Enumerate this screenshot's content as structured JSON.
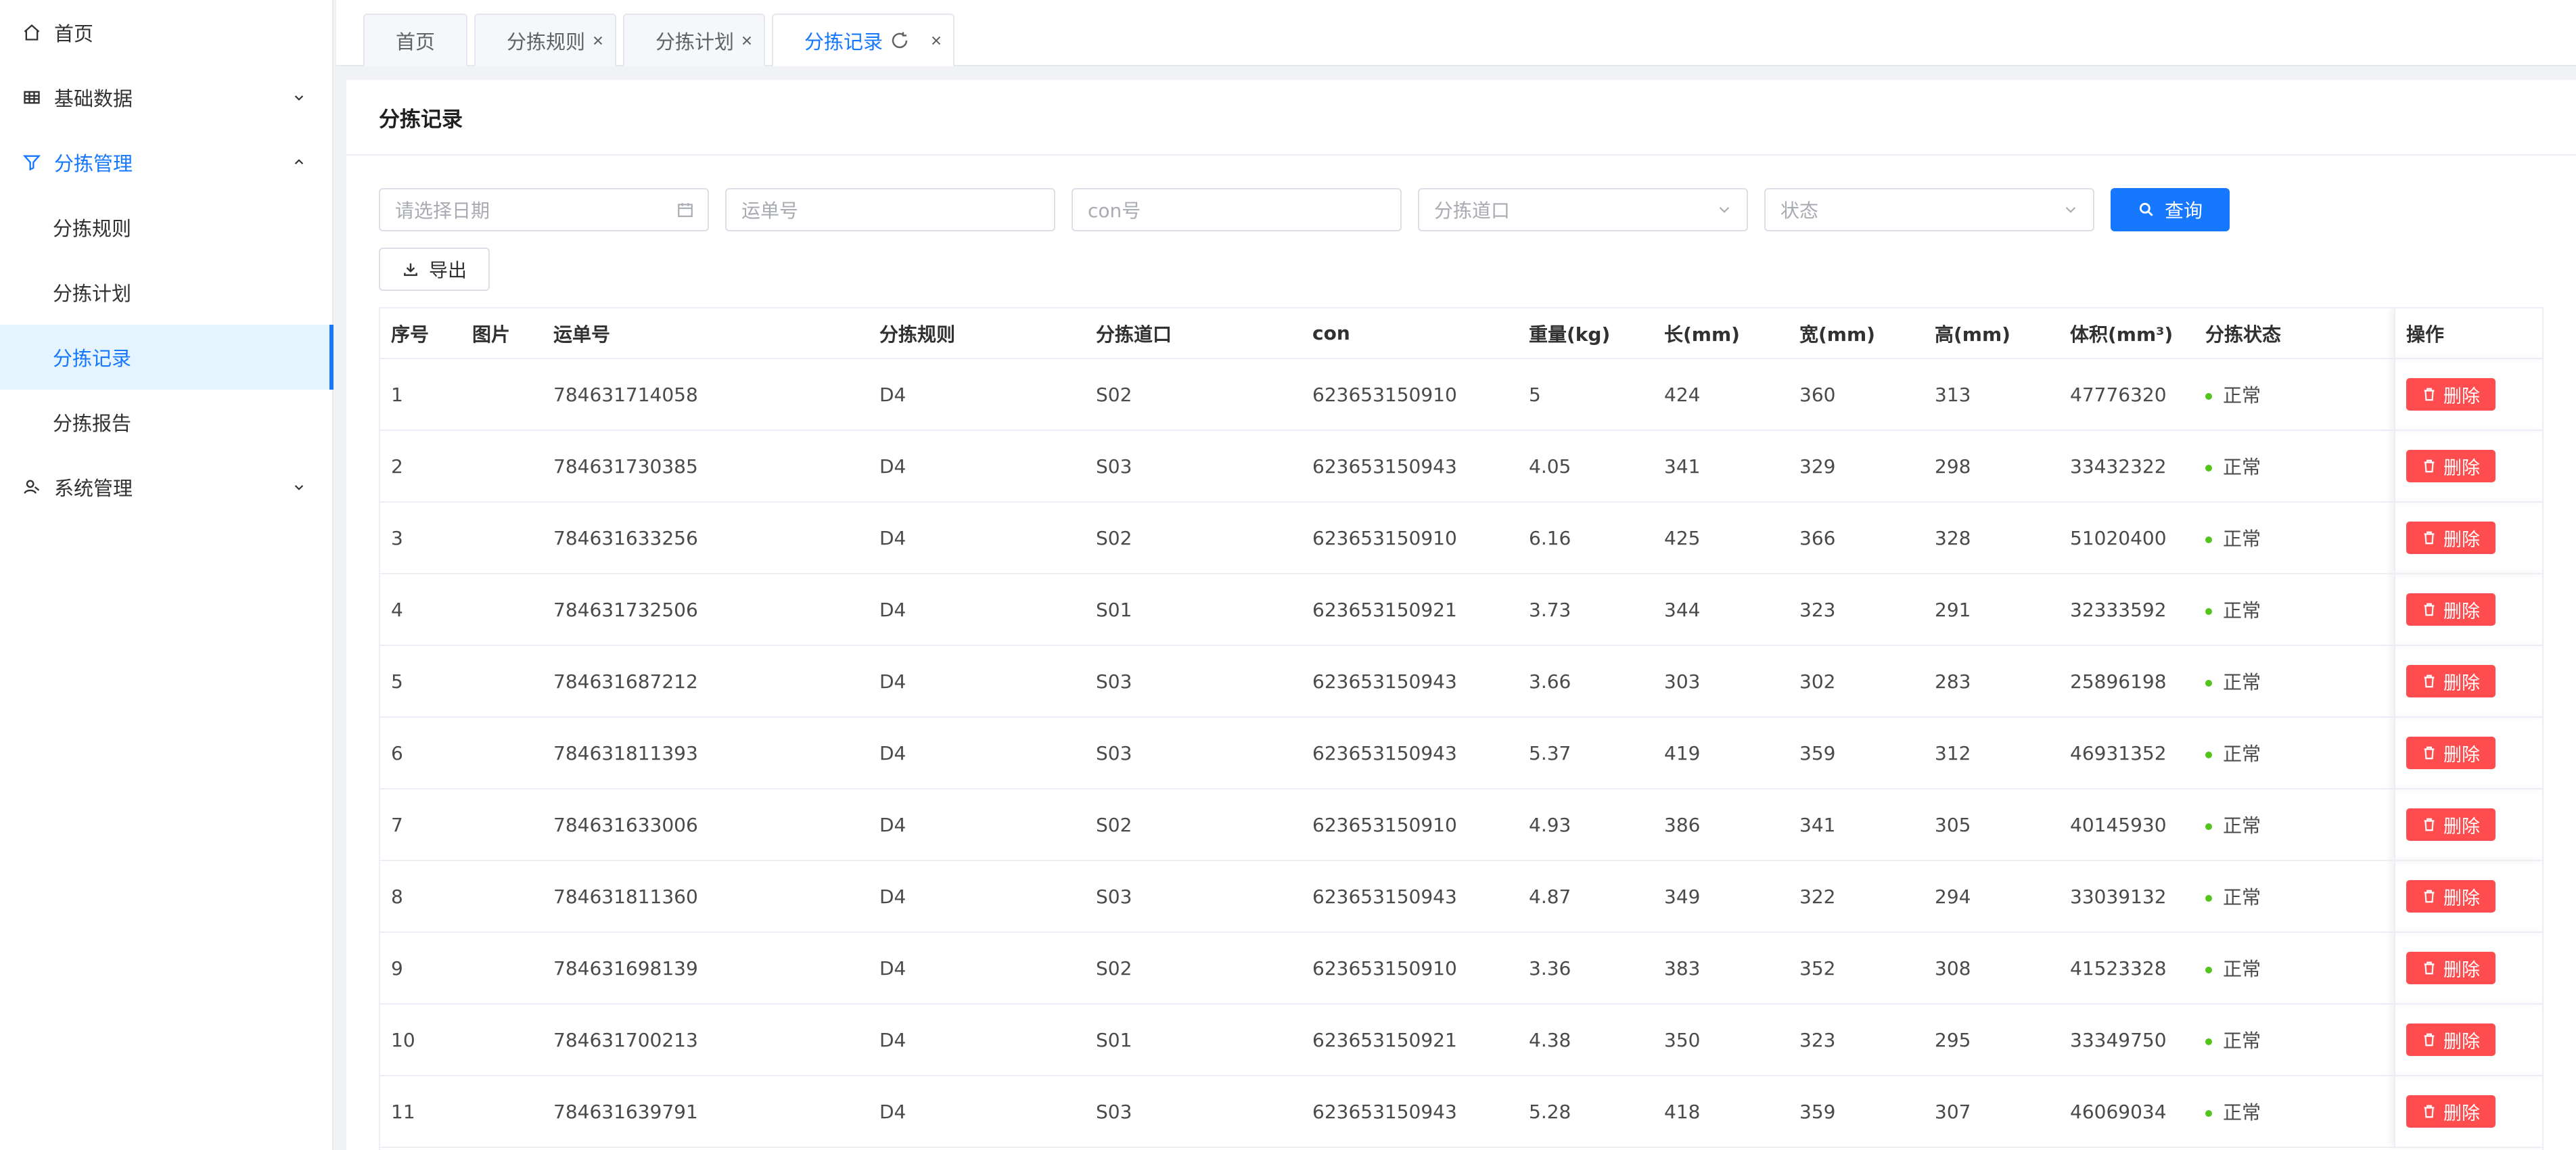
{
  "colors": {
    "primary": "#1677ff",
    "danger": "#ff4d4f",
    "success": "#52c41a"
  },
  "sidebar": {
    "items": [
      {
        "label": "首页",
        "icon": "home-icon"
      },
      {
        "label": "基础数据",
        "icon": "table-icon",
        "arrow": "chevron-down-icon"
      },
      {
        "label": "分拣管理",
        "icon": "filter-icon",
        "arrow": "chevron-up-icon"
      },
      {
        "label": "分拣规则"
      },
      {
        "label": "分拣计划"
      },
      {
        "label": "分拣记录"
      },
      {
        "label": "分拣报告"
      },
      {
        "label": "系统管理",
        "icon": "user-icon",
        "arrow": "chevron-down-icon"
      }
    ]
  },
  "tabs": [
    {
      "label": "首页"
    },
    {
      "label": "分拣规则"
    },
    {
      "label": "分拣计划"
    },
    {
      "label": "分拣记录"
    }
  ],
  "page": {
    "title": "分拣记录"
  },
  "filters": {
    "date_placeholder": "请选择日期",
    "waybill_placeholder": "运单号",
    "con_placeholder": "con号",
    "port_placeholder": "分拣道口",
    "status_placeholder": "状态",
    "query_label": "查询",
    "export_label": "导出"
  },
  "table": {
    "headers": [
      "序号",
      "图片",
      "运单号",
      "分拣规则",
      "分拣道口",
      "con",
      "重量(kg)",
      "长(mm)",
      "宽(mm)",
      "高(mm)",
      "体积(mm³)",
      "分拣状态",
      "操作"
    ],
    "delete_label": "删除",
    "rows": [
      [
        "1",
        "",
        "784631714058",
        "D4",
        "S02",
        "623653150910",
        "5",
        "424",
        "360",
        "313",
        "47776320",
        "正常"
      ],
      [
        "2",
        "",
        "784631730385",
        "D4",
        "S03",
        "623653150943",
        "4.05",
        "341",
        "329",
        "298",
        "33432322",
        "正常"
      ],
      [
        "3",
        "",
        "784631633256",
        "D4",
        "S02",
        "623653150910",
        "6.16",
        "425",
        "366",
        "328",
        "51020400",
        "正常"
      ],
      [
        "4",
        "",
        "784631732506",
        "D4",
        "S01",
        "623653150921",
        "3.73",
        "344",
        "323",
        "291",
        "32333592",
        "正常"
      ],
      [
        "5",
        "",
        "784631687212",
        "D4",
        "S03",
        "623653150943",
        "3.66",
        "303",
        "302",
        "283",
        "25896198",
        "正常"
      ],
      [
        "6",
        "",
        "784631811393",
        "D4",
        "S03",
        "623653150943",
        "5.37",
        "419",
        "359",
        "312",
        "46931352",
        "正常"
      ],
      [
        "7",
        "",
        "784631633006",
        "D4",
        "S02",
        "623653150910",
        "4.93",
        "386",
        "341",
        "305",
        "40145930",
        "正常"
      ],
      [
        "8",
        "",
        "784631811360",
        "D4",
        "S03",
        "623653150943",
        "4.87",
        "349",
        "322",
        "294",
        "33039132",
        "正常"
      ],
      [
        "9",
        "",
        "784631698139",
        "D4",
        "S02",
        "623653150910",
        "3.36",
        "383",
        "352",
        "308",
        "41523328",
        "正常"
      ],
      [
        "10",
        "",
        "784631700213",
        "D4",
        "S01",
        "623653150921",
        "4.38",
        "350",
        "323",
        "295",
        "33349750",
        "正常"
      ],
      [
        "11",
        "",
        "784631639791",
        "D4",
        "S03",
        "623653150943",
        "5.28",
        "418",
        "359",
        "307",
        "46069034",
        "正常"
      ]
    ]
  }
}
